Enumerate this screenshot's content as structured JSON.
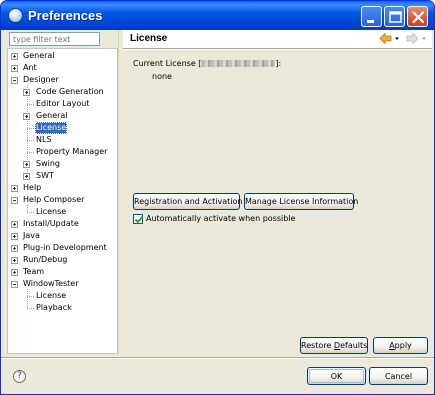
{
  "window": {
    "title": "Preferences",
    "controls": [
      "minimize-icon",
      "maximize-icon",
      "close-icon"
    ]
  },
  "filter": {
    "placeholder": "type filter text"
  },
  "tree": {
    "items": [
      {
        "label": "General",
        "level": 0,
        "expander": "plus"
      },
      {
        "label": "Ant",
        "level": 0,
        "expander": "plus"
      },
      {
        "label": "Designer",
        "level": 0,
        "expander": "minus"
      },
      {
        "label": "Code Generation",
        "level": 1,
        "expander": "plus"
      },
      {
        "label": "Editor Layout",
        "level": 1,
        "expander": "none"
      },
      {
        "label": "General",
        "level": 1,
        "expander": "plus"
      },
      {
        "label": "License",
        "level": 1,
        "expander": "none",
        "selected": true
      },
      {
        "label": "NLS",
        "level": 1,
        "expander": "none"
      },
      {
        "label": "Property Manager",
        "level": 1,
        "expander": "none"
      },
      {
        "label": "Swing",
        "level": 1,
        "expander": "plus"
      },
      {
        "label": "SWT",
        "level": 1,
        "expander": "plus"
      },
      {
        "label": "Help",
        "level": 0,
        "expander": "plus"
      },
      {
        "label": "Help Composer",
        "level": 0,
        "expander": "minus"
      },
      {
        "label": "License",
        "level": 1,
        "expander": "none"
      },
      {
        "label": "Install/Update",
        "level": 0,
        "expander": "plus"
      },
      {
        "label": "Java",
        "level": 0,
        "expander": "plus"
      },
      {
        "label": "Plug-in Development",
        "level": 0,
        "expander": "plus"
      },
      {
        "label": "Run/Debug",
        "level": 0,
        "expander": "plus"
      },
      {
        "label": "Team",
        "level": 0,
        "expander": "plus"
      },
      {
        "label": "WindowTester",
        "level": 0,
        "expander": "minus"
      },
      {
        "label": "License",
        "level": 1,
        "expander": "none"
      },
      {
        "label": "Playback",
        "level": 1,
        "expander": "none"
      }
    ]
  },
  "page": {
    "title": "License",
    "current_license_prefix": "Current License [",
    "current_license_suffix": "]:",
    "current_license_value": "none",
    "buttons": {
      "registration": "Registration and Activation",
      "manage": "Manage License Information"
    },
    "auto_activate_label": "Automatically activate when possible",
    "auto_activate_checked": true,
    "restore_defaults_a": "Restore ",
    "restore_defaults_b": "D",
    "restore_defaults_c": "efaults",
    "apply_a": "A",
    "apply_b": "pply"
  },
  "footer": {
    "ok": "OK",
    "cancel": "Cancel"
  },
  "colors": {
    "titlebar": "#0058e6",
    "selection": "#316ac5",
    "dialog_bg": "#ece9d8",
    "nav_back": "#f0b030"
  }
}
